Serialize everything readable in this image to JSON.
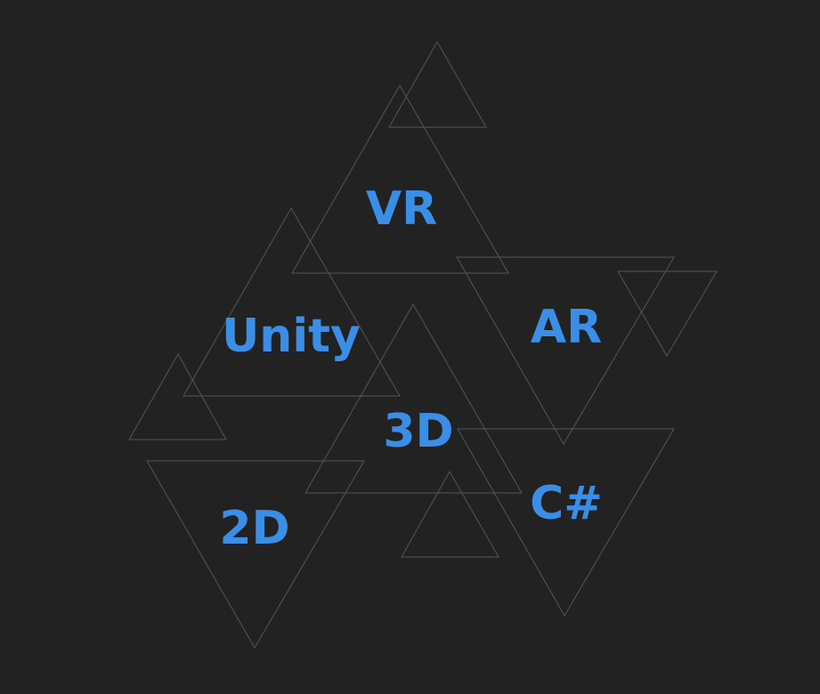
{
  "colors": {
    "background": "#222222",
    "triangle_stroke": "#555555",
    "text": "#3A8EE6"
  },
  "words": {
    "vr": "VR",
    "unity": "Unity",
    "ar": "AR",
    "three_d": "3D",
    "two_d": "2D",
    "csharp": "C#"
  }
}
